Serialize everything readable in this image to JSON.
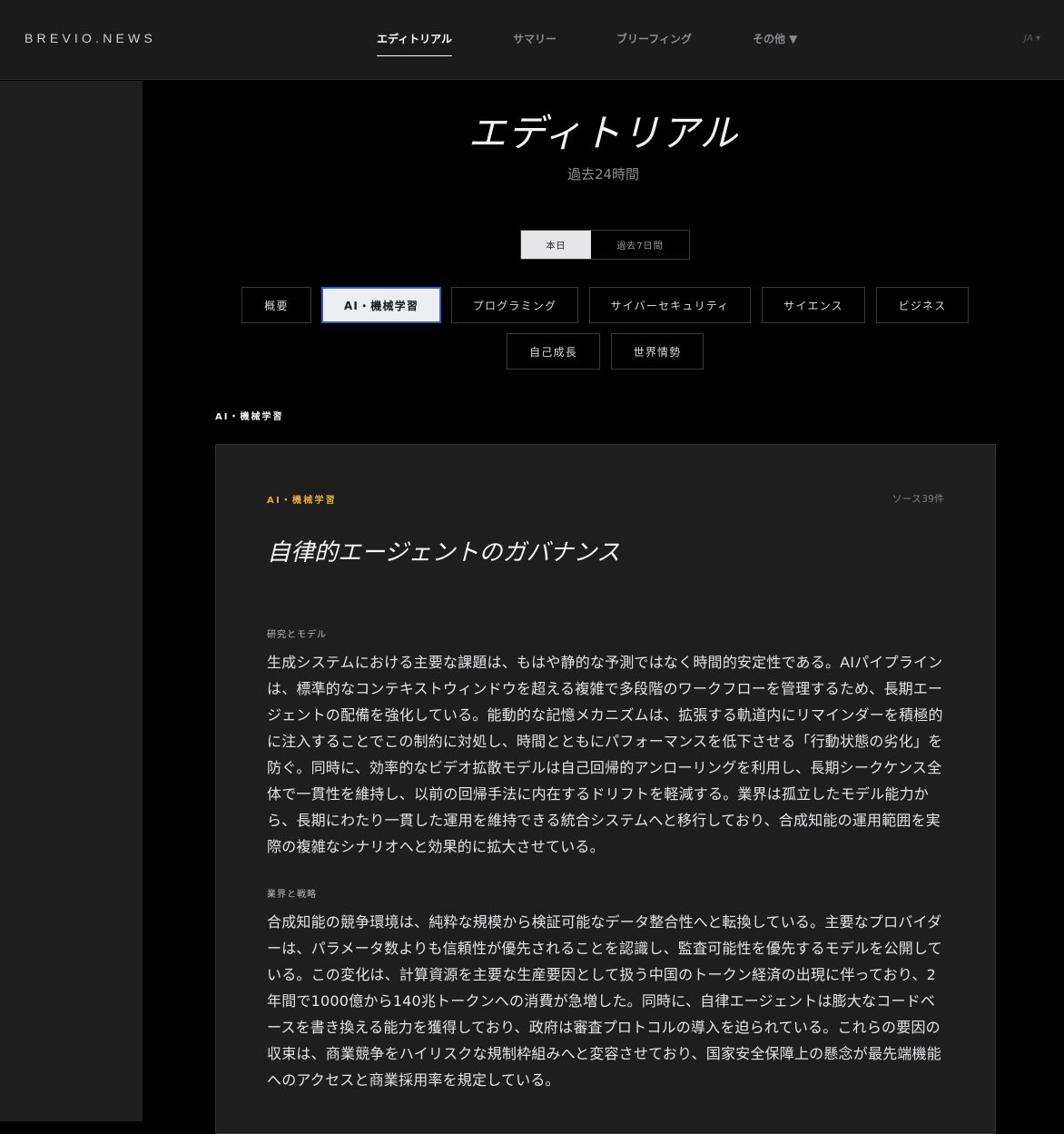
{
  "header": {
    "brand": "BREVIO.NEWS",
    "nav": [
      {
        "label": "エディトリアル",
        "active": true
      },
      {
        "label": "サマリー",
        "active": false
      },
      {
        "label": "ブリーフィング",
        "active": false
      },
      {
        "label": "その他 ▼",
        "active": false
      }
    ],
    "lang": "JA ▾"
  },
  "page": {
    "title": "エディトリアル",
    "subtitle": "過去24時間"
  },
  "range_toggle": {
    "today": "本日",
    "week": "過去7日間",
    "selected": "today"
  },
  "categories": [
    {
      "label": "概要",
      "selected": false
    },
    {
      "label": "AI・機械学習",
      "selected": true
    },
    {
      "label": "プログラミング",
      "selected": false
    },
    {
      "label": "サイバーセキュリティ",
      "selected": false
    },
    {
      "label": "サイエンス",
      "selected": false
    },
    {
      "label": "ビジネス",
      "selected": false
    },
    {
      "label": "自己成長",
      "selected": false
    },
    {
      "label": "世界情勢",
      "selected": false
    }
  ],
  "section_label": "AI・機械学習",
  "article": {
    "category": "AI・機械学習",
    "sources": "ソース39件",
    "title": "自律的エージェントのガバナンス",
    "sections": [
      {
        "heading": "研究とモデル",
        "body": "生成システムにおける主要な課題は、もはや静的な予測ではなく時間的安定性である。AIパイプラインは、標準的なコンテキストウィンドウを超える複雑で多段階のワークフローを管理するため、長期エージェントの配備を強化している。能動的な記憶メカニズムは、拡張する軌道内にリマインダーを積極的に注入することでこの制約に対処し、時間とともにパフォーマンスを低下させる「行動状態の劣化」を防ぐ。同時に、効率的なビデオ拡散モデルは自己回帰的アンローリングを利用し、長期シークケンス全体で一貫性を維持し、以前の回帰手法に内在するドリフトを軽減する。業界は孤立したモデル能力から、長期にわたり一貫した運用を維持できる統合システムへと移行しており、合成知能の運用範囲を実際の複雑なシナリオへと効果的に拡大させている。"
      },
      {
        "heading": "業界と戦略",
        "body": "合成知能の競争環境は、純粋な規模から検証可能なデータ整合性へと転換している。主要なプロバイダーは、パラメータ数よりも信頼性が優先されることを認識し、監査可能性を優先するモデルを公開している。この変化は、計算資源を主要な生産要因として扱う中国のトークン経済の出現に伴っており、2年間で1000億から140兆トークンへの消費が急増した。同時に、自律エージェントは膨大なコードベースを書き換える能力を獲得しており、政府は審査プロトコルの導入を迫られている。これらの要因の収束は、商業競争をハイリスクな規制枠組みへと変容させており、国家安全保障上の懸念が最先端機能へのアクセスと商業採用率を規定している。"
      }
    ]
  }
}
